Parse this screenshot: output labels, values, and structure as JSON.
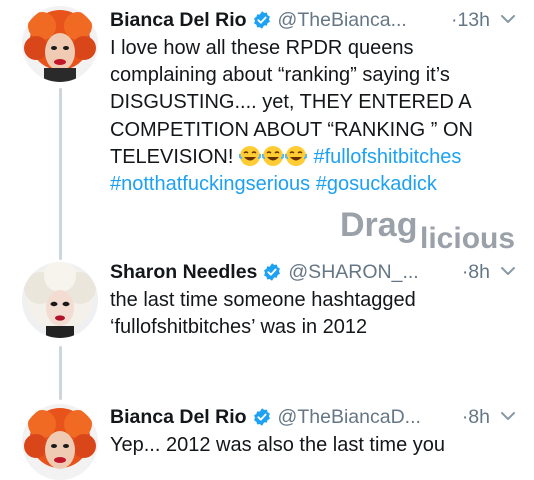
{
  "tweets": [
    {
      "name": "Bianca Del Rio",
      "handle": "@TheBianca...",
      "time": "·13h",
      "text_lines": [
        "I love how all these RPDR queens",
        "complaining about “ranking” saying it’s",
        "DISGUSTING.... yet, THEY ENTERED A",
        "COMPETITION ABOUT “RANKING ” ON",
        "TELEVISION!"
      ],
      "emojis": [
        "laughing-crying-emoji",
        "laughing-crying-emoji",
        "laughing-crying-emoji"
      ],
      "hashtags": [
        "#fullofshitbitches",
        "#notthatfuckingserious",
        "#gosuckadick"
      ]
    },
    {
      "name": "Sharon Needles",
      "handle": "@SHARON_...",
      "time": "·8h",
      "text_lines": [
        "the last time someone hashtagged",
        "‘fullofshitbitches’ was in 2012"
      ]
    },
    {
      "name": "Bianca Del Rio",
      "handle": "@TheBiancaD...",
      "time": "·8h",
      "text_lines": [
        "Yep... 2012 was also the last time you"
      ]
    }
  ],
  "watermark": {
    "text": "Draglicious"
  },
  "icons": {
    "verified": "verified-badge-icon",
    "menu": "chevron-down-icon"
  },
  "colors": {
    "hashtag": "#1da1f2",
    "verified": "#1da1f2",
    "secondary": "#657786",
    "thread_line": "#ccd6dd"
  }
}
